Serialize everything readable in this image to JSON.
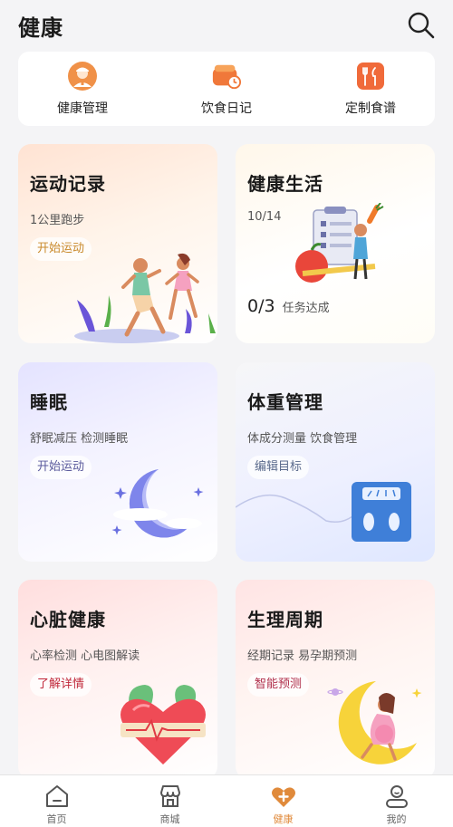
{
  "header": {
    "title": "健康"
  },
  "quick": [
    {
      "label": "健康管理",
      "icon": "doctor-icon"
    },
    {
      "label": "饮食日记",
      "icon": "food-clock-icon"
    },
    {
      "label": "定制食谱",
      "icon": "fork-knife-icon"
    }
  ],
  "cards": {
    "exercise": {
      "title": "运动记录",
      "subtitle": "1公里跑步",
      "button": "开始运动"
    },
    "healthy_life": {
      "title": "健康生活",
      "date": "10/14",
      "progress": "0/3",
      "progress_label": "任务达成"
    },
    "sleep": {
      "title": "睡眠",
      "subtitle": "舒眠减压 检测睡眠",
      "button": "开始运动"
    },
    "weight": {
      "title": "体重管理",
      "subtitle": "体成分测量 饮食管理",
      "button": "编辑目标"
    },
    "heart": {
      "title": "心脏健康",
      "subtitle": "心率检测 心电图解读",
      "button": "了解详情"
    },
    "period": {
      "title": "生理周期",
      "subtitle": "经期记录 易孕期预测",
      "button": "智能预测"
    }
  },
  "tabs": [
    {
      "label": "首页",
      "icon": "home-icon"
    },
    {
      "label": "商城",
      "icon": "shop-icon"
    },
    {
      "label": "健康",
      "icon": "heart-plus-icon",
      "active": true
    },
    {
      "label": "我的",
      "icon": "profile-icon"
    }
  ],
  "colors": {
    "accent": "#e08a3b",
    "exercise_button": "#c98a2c",
    "sleep_button": "#5a5a9c",
    "weight_button": "#5a6a8c",
    "heart_button": "#c0283a",
    "period_button": "#b0304c"
  }
}
